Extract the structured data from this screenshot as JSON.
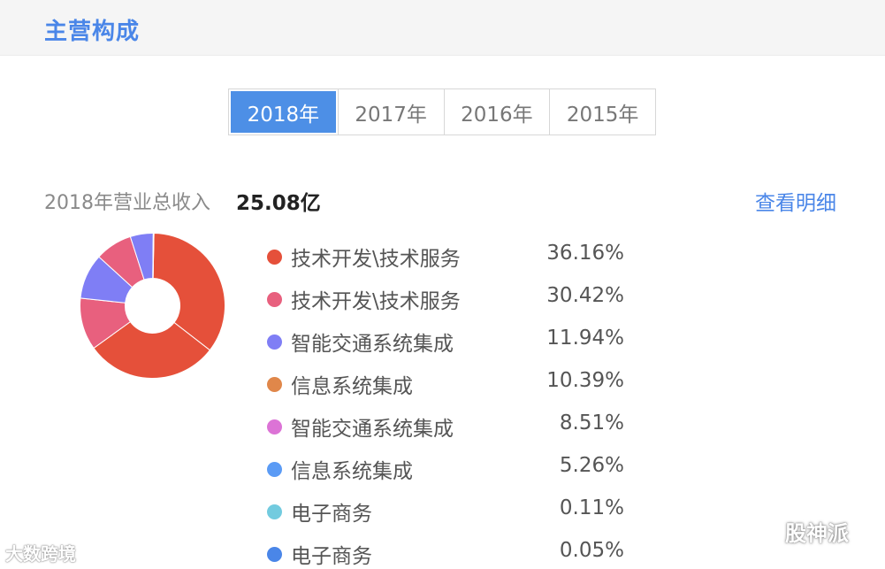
{
  "header": {
    "title": "主营构成"
  },
  "tabs": [
    {
      "label": "2018年",
      "active": true
    },
    {
      "label": "2017年",
      "active": false
    },
    {
      "label": "2016年",
      "active": false
    },
    {
      "label": "2015年",
      "active": false
    }
  ],
  "summary": {
    "label": "2018年营业总收入",
    "value": "25.08亿",
    "detail_link": "查看明细"
  },
  "chart_data": {
    "type": "pie",
    "title": "",
    "series": [
      {
        "name": "技术开发\\技术服务",
        "value": 36.16,
        "label": "36.16%",
        "color": "#e5503a"
      },
      {
        "name": "技术开发\\技术服务",
        "value": 30.42,
        "label": "30.42%",
        "color": "#e5503a"
      },
      {
        "name": "智能交通系统集成",
        "value": 11.94,
        "label": "11.94%",
        "color": "#e8607e"
      },
      {
        "name": "信息系统集成",
        "value": 10.39,
        "label": "10.39%",
        "color": "#7f7ef5"
      },
      {
        "name": "智能交通系统集成",
        "value": 8.51,
        "label": "8.51%",
        "color": "#e8607e"
      },
      {
        "name": "信息系统集成",
        "value": 5.26,
        "label": "5.26%",
        "color": "#7f7ef5"
      },
      {
        "name": "电子商务",
        "value": 0.11,
        "label": "0.11%",
        "color": "#e5503a"
      },
      {
        "name": "电子商务",
        "value": 0.05,
        "label": "0.05%",
        "color": "#e5503a"
      }
    ]
  },
  "legend": [
    {
      "name": "技术开发\\技术服务",
      "pct": "36.16%",
      "color": "#e5503a"
    },
    {
      "name": "技术开发\\技术服务",
      "pct": "30.42%",
      "color": "#e8607e"
    },
    {
      "name": "智能交通系统集成",
      "pct": "11.94%",
      "color": "#7f7ef5"
    },
    {
      "name": "信息系统集成",
      "pct": "10.39%",
      "color": "#e0874a"
    },
    {
      "name": "智能交通系统集成",
      "pct": "8.51%",
      "color": "#dc73d6"
    },
    {
      "name": "信息系统集成",
      "pct": "5.26%",
      "color": "#5b9bf5"
    },
    {
      "name": "电子商务",
      "pct": "0.11%",
      "color": "#72cbdf"
    },
    {
      "name": "电子商务",
      "pct": "0.05%",
      "color": "#4a86e8"
    }
  ],
  "watermarks": {
    "left": "大数跨境",
    "right": "股神派"
  }
}
